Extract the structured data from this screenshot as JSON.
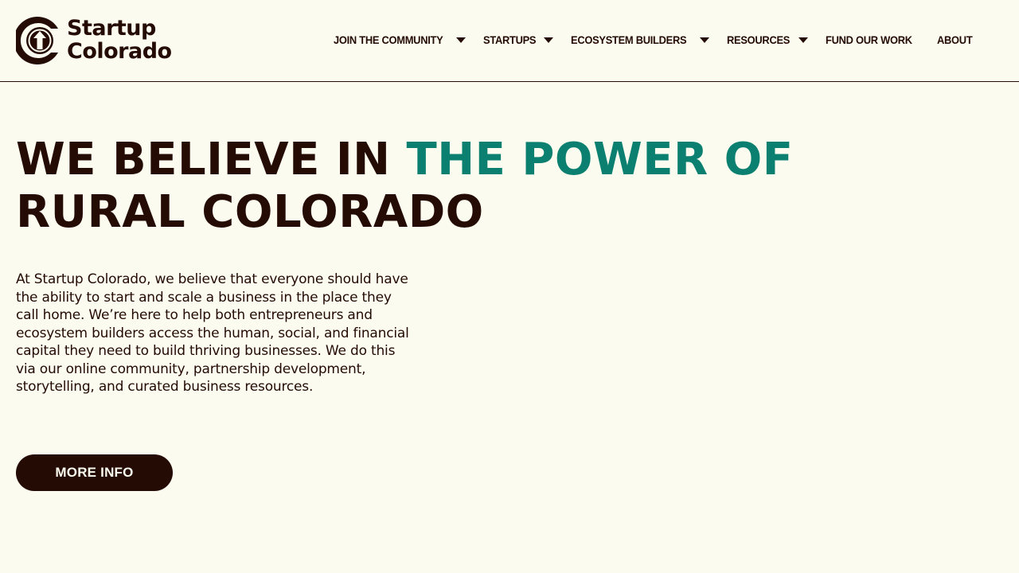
{
  "brand": {
    "name_line1": "Startup",
    "name_line2": "Colorado",
    "logo_icon": "up-arrow-c-icon",
    "colors": {
      "background": "#FBFBEF",
      "text": "#240B04",
      "accent": "#0B8070"
    }
  },
  "nav": {
    "items": [
      {
        "label": "JOIN THE COMMUNITY",
        "has_dropdown": true
      },
      {
        "label": "STARTUPS",
        "has_dropdown": true
      },
      {
        "label": "ECOSYSTEM BUILDERS",
        "has_dropdown": true
      },
      {
        "label": "RESOURCES",
        "has_dropdown": true
      },
      {
        "label": "FUND OUR WORK",
        "has_dropdown": false
      },
      {
        "label": "ABOUT",
        "has_dropdown": false
      }
    ]
  },
  "hero": {
    "title_part1": "WE BELIEVE IN ",
    "title_accent": "THE POWER OF",
    "title_line2": "RURAL COLORADO",
    "body": "At Startup Colorado, we believe that everyone should have the ability to start and scale a business in the place they call home. We’re here to help both entrepreneurs and ecosystem builders access the human, social, and financial capital they need to build thriving businesses. We do this via our online community, partnership development, storytelling, and curated business resources.",
    "cta_label": "MORE INFO"
  }
}
